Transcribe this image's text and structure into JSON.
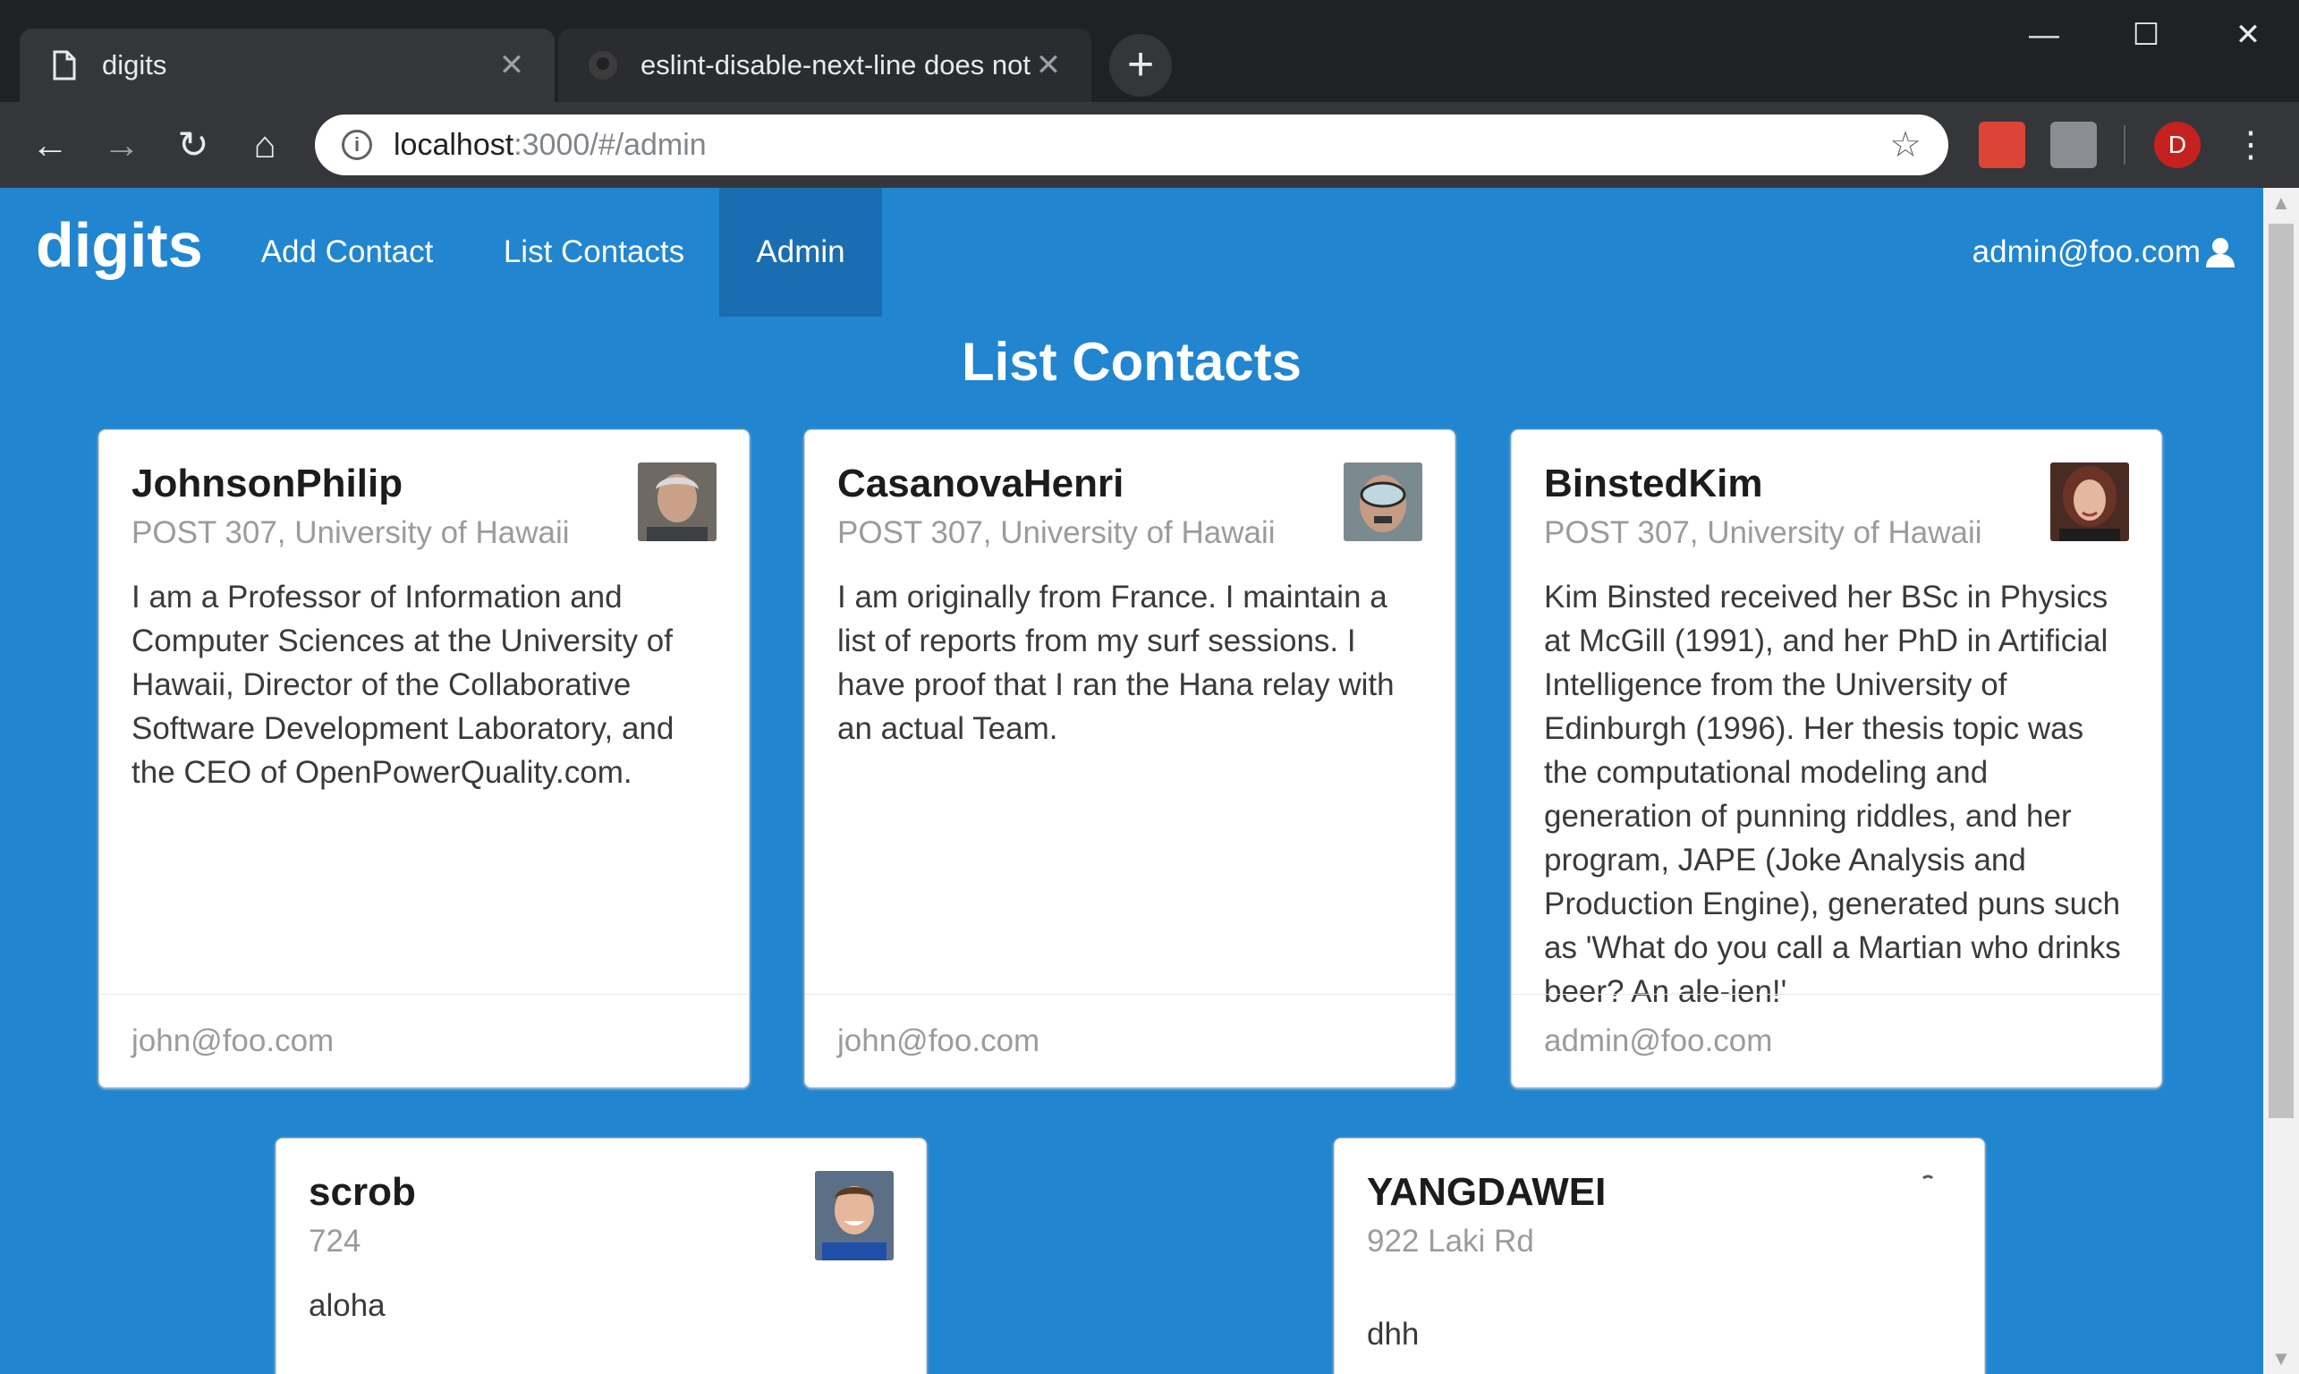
{
  "browser": {
    "tabs": [
      {
        "title": "digits",
        "icon": "page-icon",
        "active": true
      },
      {
        "title": "eslint-disable-next-line does not",
        "icon": "github-icon",
        "active": false
      }
    ],
    "url_host": "localhost",
    "url_path": ":3000/#/admin",
    "profile_initial": "D"
  },
  "navbar": {
    "brand": "digits",
    "items": [
      {
        "label": "Add Contact",
        "active": false
      },
      {
        "label": "List Contacts",
        "active": false
      },
      {
        "label": "Admin",
        "active": true
      }
    ],
    "user": "admin@foo.com"
  },
  "page": {
    "title": "List Contacts"
  },
  "contacts": [
    {
      "name": "JohnsonPhilip",
      "address": "POST 307, University of Hawaii",
      "description": "I am a Professor of Information and Computer Sciences at the University of Hawaii, Director of the Collaborative Software Development Laboratory, and the CEO of OpenPowerQuality.com.",
      "owner": "john@foo.com"
    },
    {
      "name": "CasanovaHenri",
      "address": "POST 307, University of Hawaii",
      "description": "I am originally from France. I maintain a list of reports from my surf sessions. I have proof that I ran the Hana relay with an actual Team.",
      "owner": "john@foo.com"
    },
    {
      "name": "BinstedKim",
      "address": "POST 307, University of Hawaii",
      "description": "Kim Binsted received her BSc in Physics at McGill (1991), and her PhD in Artificial Intelligence from the University of Edinburgh (1996). Her thesis topic was the computational modeling and generation of punning riddles, and her program, JAPE (Joke Analysis and Production Engine), generated puns such as 'What do you call a Martian who drinks beer? An ale-ien!'",
      "owner": "admin@foo.com"
    },
    {
      "name": "scrob",
      "address": "724",
      "description": "aloha",
      "owner": ""
    },
    {
      "name": "YANGDAWEI",
      "address": "922 Laki Rd",
      "description": "dhh",
      "owner": ""
    }
  ],
  "colors": {
    "navbar": "#2185d0",
    "active_menu": "#1a6db0",
    "chrome_dark": "#202124"
  }
}
